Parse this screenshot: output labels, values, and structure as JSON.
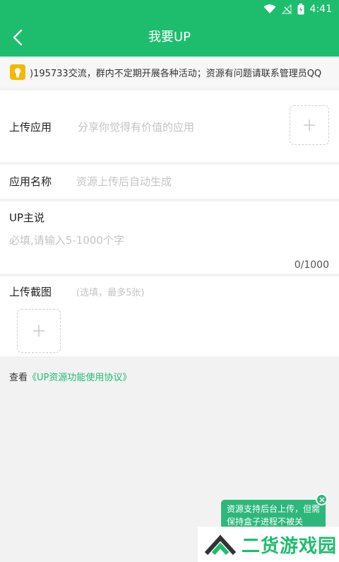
{
  "status_bar": {
    "time": "4:41"
  },
  "header": {
    "title": "我要UP"
  },
  "notice": {
    "text": ")195733交流，群内不定期开展各种活动；资源有问题请联系管理员QQ"
  },
  "upload_app": {
    "label": "上传应用",
    "hint": "分享你觉得有价值的应用"
  },
  "app_name": {
    "label": "应用名称",
    "placeholder": "资源上传后自动生成"
  },
  "up_says": {
    "label": "UP主说",
    "placeholder": "必填,请输入5-1000个字",
    "counter": "0/1000"
  },
  "screenshots": {
    "label": "上传截图",
    "hint": "(选填，最多5张)"
  },
  "agreement": {
    "prefix": "查看",
    "link": "《UP资源功能使用协议》"
  },
  "tip": {
    "text": "资源支持后台上传，但需保持盒子进程不被关"
  },
  "watermark": {
    "text": "二货游戏园"
  },
  "colors": {
    "primary": "#1ebd6e",
    "notice_icon": "#f5b800"
  }
}
